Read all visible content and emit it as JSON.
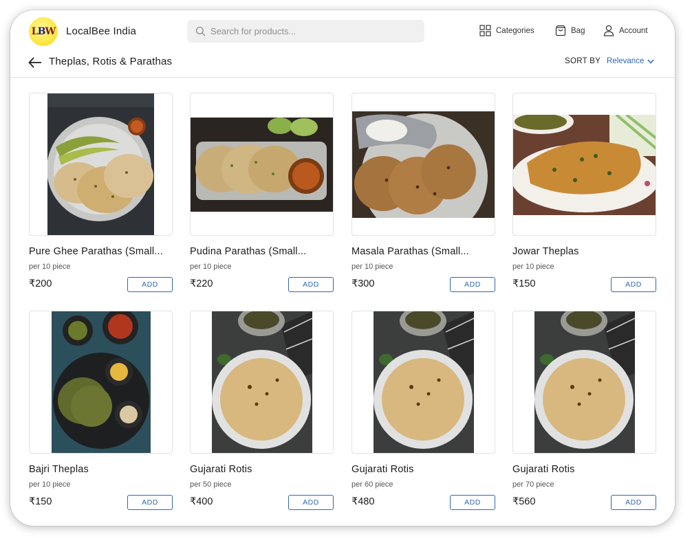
{
  "header": {
    "brand_name": "LocalBee India",
    "logo_text_l": "L",
    "logo_text_b": "B",
    "logo_text_w": "W",
    "search_placeholder": "Search for products...",
    "nav": {
      "categories": "Categories",
      "bag": "Bag",
      "account": "Account"
    }
  },
  "subheader": {
    "title": "Theplas, Rotis & Parathas",
    "sort_label": "SORT BY",
    "sort_value": "Relevance"
  },
  "colors": {
    "accent": "#2f67b1",
    "logo_yellow": "#ffe94a"
  },
  "products": [
    {
      "name": "Pure Ghee Parathas (Small...",
      "qty": "per 10 piece",
      "price": "₹200",
      "add": "ADD",
      "image": "ghee-paratha-plate"
    },
    {
      "name": "Pudina Parathas (Small...",
      "qty": "per 10 piece",
      "price": "₹220",
      "add": "ADD",
      "image": "pudina-paratha-plate"
    },
    {
      "name": "Masala Parathas (Small...",
      "qty": "per 10 piece",
      "price": "₹300",
      "add": "ADD",
      "image": "masala-paratha-plate"
    },
    {
      "name": "Jowar Theplas",
      "qty": "per 10 piece",
      "price": "₹150",
      "add": "ADD",
      "image": "jowar-thepla-plate"
    },
    {
      "name": "Bajri Theplas",
      "qty": "per 10 piece",
      "price": "₹150",
      "add": "ADD",
      "image": "bajri-thepla-thali"
    },
    {
      "name": "Gujarati Rotis",
      "qty": "per 50 piece",
      "price": "₹400",
      "add": "ADD",
      "image": "gujarati-roti-plate"
    },
    {
      "name": "Gujarati Rotis",
      "qty": "per 60 piece",
      "price": "₹480",
      "add": "ADD",
      "image": "gujarati-roti-plate"
    },
    {
      "name": "Gujarati Rotis",
      "qty": "per 70 piece",
      "price": "₹560",
      "add": "ADD",
      "image": "gujarati-roti-plate"
    }
  ]
}
